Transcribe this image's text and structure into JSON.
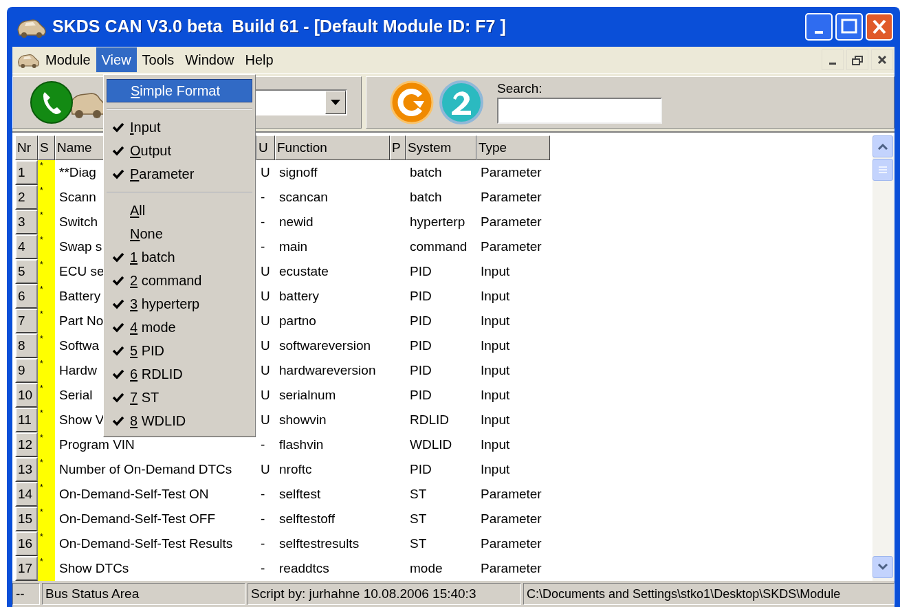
{
  "window": {
    "title": "SKDS CAN V3.0 beta  Build 61 - [Default Module ID: F7 ]"
  },
  "menu_bar": [
    {
      "label": "Module",
      "selected": false
    },
    {
      "label": "View",
      "selected": true
    },
    {
      "label": "Tools",
      "selected": false
    },
    {
      "label": "Window",
      "selected": false
    },
    {
      "label": "Help",
      "selected": false
    }
  ],
  "view_menu": [
    {
      "kind": "item",
      "label": "Simple Format",
      "checked": false,
      "selected": true
    },
    {
      "kind": "separator"
    },
    {
      "kind": "item",
      "label": "Input",
      "checked": true,
      "selected": false
    },
    {
      "kind": "item",
      "label": "Output",
      "checked": true,
      "selected": false
    },
    {
      "kind": "item",
      "label": "Parameter",
      "checked": true,
      "selected": false
    },
    {
      "kind": "separator"
    },
    {
      "kind": "item",
      "label": "All",
      "checked": false,
      "selected": false
    },
    {
      "kind": "item",
      "label": "None",
      "checked": false,
      "selected": false
    },
    {
      "kind": "item",
      "label": "1 batch",
      "checked": true,
      "selected": false
    },
    {
      "kind": "item",
      "label": "2 command",
      "checked": true,
      "selected": false
    },
    {
      "kind": "item",
      "label": "3 hyperterp",
      "checked": true,
      "selected": false
    },
    {
      "kind": "item",
      "label": "4 mode",
      "checked": true,
      "selected": false
    },
    {
      "kind": "item",
      "label": "5 PID",
      "checked": true,
      "selected": false
    },
    {
      "kind": "item",
      "label": "6 RDLID",
      "checked": true,
      "selected": false
    },
    {
      "kind": "item",
      "label": "7 ST",
      "checked": true,
      "selected": false
    },
    {
      "kind": "item",
      "label": "8 WDLID",
      "checked": true,
      "selected": false
    }
  ],
  "toolbar": {
    "search_label": "Search:"
  },
  "table": {
    "columns": [
      "Nr",
      "S",
      "Name",
      "U",
      "Function",
      "P",
      "System",
      "Type"
    ],
    "rows": [
      {
        "nr": "1",
        "s": "*",
        "name": "**Diag",
        "u": "U",
        "function": "signoff",
        "system": "batch",
        "type": "Parameter"
      },
      {
        "nr": "2",
        "s": "*",
        "name": "Scann",
        "u": "-",
        "function": "scancan",
        "system": "batch",
        "type": "Parameter"
      },
      {
        "nr": "3",
        "s": "*",
        "name": "Switch",
        "u": "-",
        "function": "newid",
        "system": "hyperterp",
        "type": "Parameter"
      },
      {
        "nr": "4",
        "s": "*",
        "name": "Swap s",
        "u": "-",
        "function": "main",
        "system": "command",
        "type": "Parameter"
      },
      {
        "nr": "5",
        "s": "*",
        "name": "ECU se",
        "u": "U",
        "function": "ecustate",
        "system": "PID",
        "type": "Input"
      },
      {
        "nr": "6",
        "s": "*",
        "name": "Battery",
        "u": "U",
        "function": "battery",
        "system": "PID",
        "type": "Input"
      },
      {
        "nr": "7",
        "s": "*",
        "name": "Part No",
        "u": "U",
        "function": "partno",
        "system": "PID",
        "type": "Input"
      },
      {
        "nr": "8",
        "s": "*",
        "name": "Softwa",
        "u": "U",
        "function": "softwareversion",
        "system": "PID",
        "type": "Input"
      },
      {
        "nr": "9",
        "s": "*",
        "name": "Hardw",
        "u": "U",
        "function": "hardwareversion",
        "system": "PID",
        "type": "Input"
      },
      {
        "nr": "10",
        "s": "*",
        "name": "Serial",
        "u": "U",
        "function": "serialnum",
        "system": "PID",
        "type": "Input"
      },
      {
        "nr": "11",
        "s": "*",
        "name": "Show V",
        "u": "U",
        "function": "showvin",
        "system": "RDLID",
        "type": "Input"
      },
      {
        "nr": "12",
        "s": "*",
        "name": "Program VIN",
        "u": "-",
        "function": "flashvin",
        "system": "WDLID",
        "type": "Input"
      },
      {
        "nr": "13",
        "s": "*",
        "name": "Number of On-Demand DTCs",
        "u": "U",
        "function": "nroftc",
        "system": "PID",
        "type": "Input"
      },
      {
        "nr": "14",
        "s": "*",
        "name": "On-Demand-Self-Test ON",
        "u": "-",
        "function": "selftest",
        "system": "ST",
        "type": "Parameter"
      },
      {
        "nr": "15",
        "s": "*",
        "name": "On-Demand-Self-Test OFF",
        "u": "-",
        "function": "selftestoff",
        "system": "ST",
        "type": "Parameter"
      },
      {
        "nr": "16",
        "s": "*",
        "name": "On-Demand-Self-Test Results",
        "u": "-",
        "function": "selftestresults",
        "system": "ST",
        "type": "Parameter"
      },
      {
        "nr": "17",
        "s": "*",
        "name": "Show DTCs",
        "u": "-",
        "function": "readdtcs",
        "system": "mode",
        "type": "Parameter"
      }
    ]
  },
  "status_bar": [
    "--",
    "Bus Status Area",
    "Script by: jurhahne 10.08.2006 15:40:3",
    "C:\\Documents and Settings\\stko1\\Desktop\\SKDS\\Module"
  ]
}
